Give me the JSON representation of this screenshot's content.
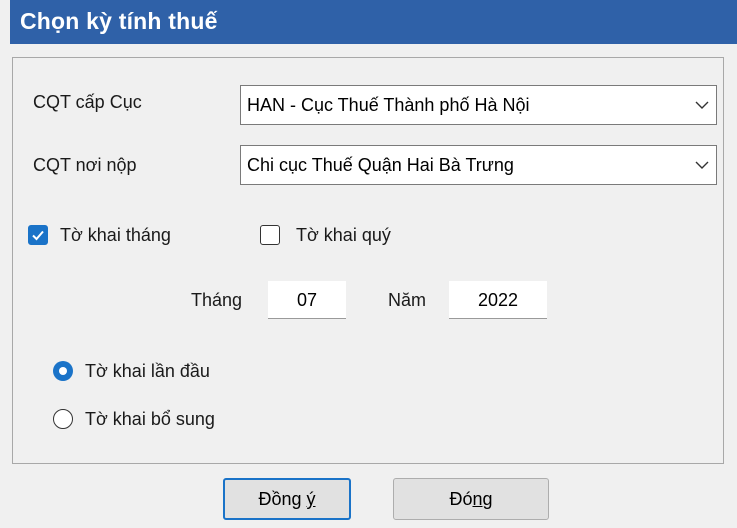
{
  "window": {
    "title": "Chọn kỳ tính thuế"
  },
  "form": {
    "cqt_cap_cuc": {
      "label": "CQT cấp Cục",
      "value": "HAN - Cục Thuế Thành phố Hà Nội"
    },
    "cqt_noi_nop": {
      "label": "CQT nơi nộp",
      "value": "Chi cục Thuế Quận Hai Bà Trưng"
    },
    "period_type": {
      "monthly": {
        "label": "Tờ khai tháng",
        "checked": true
      },
      "quarterly": {
        "label": "Tờ khai quý",
        "checked": false
      }
    },
    "month": {
      "label": "Tháng",
      "value": "07"
    },
    "year": {
      "label": "Năm",
      "value": "2022"
    },
    "declaration_type": {
      "first": {
        "label": "Tờ khai lần đầu",
        "selected": true
      },
      "supplement": {
        "label": "Tờ khai bổ sung",
        "selected": false
      }
    }
  },
  "buttons": {
    "ok": {
      "label_pre": "Đồng ",
      "label_mnemonic": "ý",
      "label_post": ""
    },
    "close": {
      "label_pre": "Đó",
      "label_mnemonic": "n",
      "label_post": "g"
    }
  },
  "colors": {
    "titlebar": "#2f61a8",
    "accent": "#1a73c8"
  }
}
